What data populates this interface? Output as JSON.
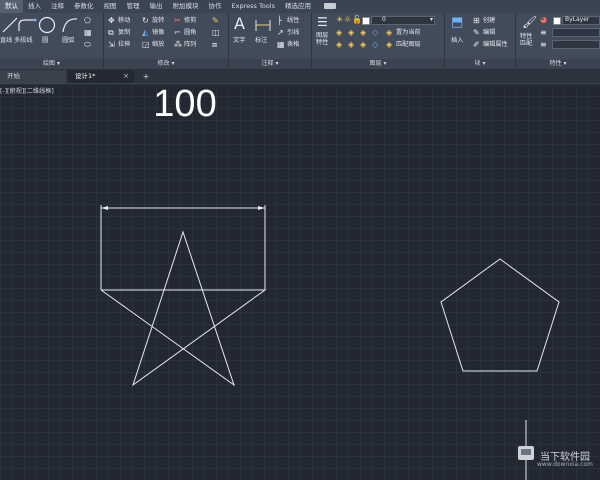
{
  "menu": [
    "默认",
    "插入",
    "注释",
    "参数化",
    "视图",
    "管理",
    "输出",
    "附加模块",
    "协作",
    "Express Tools",
    "精选应用"
  ],
  "ribbon": {
    "draw": {
      "line": "直线",
      "polyline": "多段线",
      "circle": "圆",
      "arc": "圆弧",
      "title": "绘图"
    },
    "modify": {
      "move": "移动",
      "rotate": "旋转",
      "trim": "修剪",
      "copy": "复制",
      "mirror": "镜像",
      "fillet": "圆角",
      "stretch": "拉伸",
      "scale": "缩放",
      "array": "阵列",
      "title": "修改"
    },
    "annotation": {
      "text": "文字",
      "dimension": "标注",
      "leader": "线性",
      "multileader": "引线",
      "table": "表格",
      "title": "注释"
    },
    "layers": {
      "properties": "图层特性",
      "current_layer": "0",
      "make_current": "置为当前",
      "match": "匹配图层",
      "title": "图层"
    },
    "block": {
      "insert": "插入",
      "create": "创建",
      "edit": "编辑",
      "edit_attributes": "编辑属性",
      "title": "块"
    },
    "properties": {
      "match": "特性匹配",
      "bylayer": "ByLayer",
      "title": "特性"
    }
  },
  "tabs": {
    "start": "开始",
    "design": "设计1*",
    "close": "×",
    "add": "+"
  },
  "viewport": "[-][俯视][二维线框]",
  "drawing": {
    "dimension_value": "100"
  },
  "watermark": {
    "text": "当下软件园",
    "url": "www.downxia.com"
  },
  "colors": {
    "canvas": "#222732",
    "ribbon": "#424b59",
    "accent": "#6fb1ff"
  }
}
